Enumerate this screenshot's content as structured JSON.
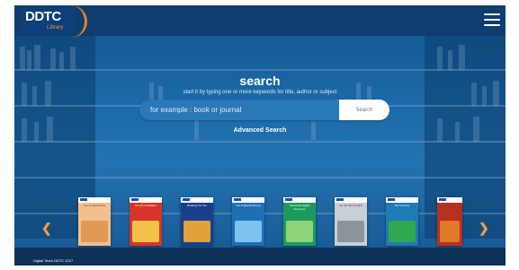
{
  "header": {
    "logo_text": "DDTC",
    "logo_subtext": "Library",
    "menu_icon": "hamburger-menu-icon"
  },
  "search": {
    "title": "search",
    "subtitle": "start it by typing one or more keywords for title, author or subject",
    "placeholder": "for example : book or journal",
    "button_label": "Search",
    "advanced_label": "Advanced Search"
  },
  "carousel": {
    "prev_icon": "chevron-left-icon",
    "next_icon": "chevron-right-icon",
    "books": [
      {
        "cover_text": "The Goodwill Rule",
        "color": "#f2c08c"
      },
      {
        "cover_text": "Not So Forbidden",
        "color": "#d9342b"
      },
      {
        "cover_text": "Reading the Tax",
        "color": "#1b3f8b"
      },
      {
        "cover_text": "The Digital Economy",
        "color": "#1f6fb5"
      },
      {
        "cover_text": "Indonesia Digital Economy",
        "color": "#1c9a5e"
      },
      {
        "cover_text": "On the Tax Frontier",
        "color": "#c9cfd6"
      },
      {
        "cover_text": "Tax Amnesty",
        "color": "#1f7ab8"
      },
      {
        "cover_text": "",
        "color": "#b8301f"
      }
    ]
  },
  "footer": {
    "text": "Digital Team DDTC 2017"
  }
}
